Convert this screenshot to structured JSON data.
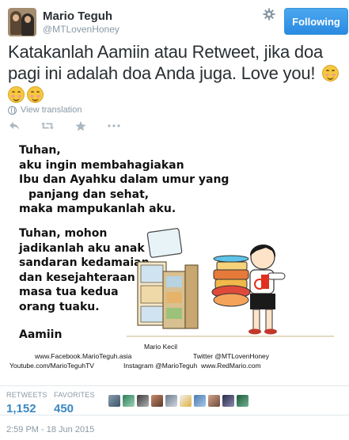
{
  "user": {
    "display_name": "Mario Teguh",
    "screen_name": "@MTLovenHoney"
  },
  "follow_button": {
    "label": "Following",
    "color": "#2b8ae0"
  },
  "tweet": {
    "line1": "Katakanlah Aamiin atau Retweet, jika doa",
    "line2": "pagi ini adalah doa Anda juga. Love you!",
    "emoji_name": "smiling-face-with-smiling-eyes-emoji"
  },
  "translate_link": "View translation",
  "actions": [
    "reply-icon",
    "retweet-icon",
    "favorite-icon",
    "more-icon"
  ],
  "image": {
    "para1": [
      "Tuhan,",
      "aku ingin membahagiakan",
      "Ibu dan Ayahku dalam umur yang",
      "panjang dan sehat,",
      "maka mampukanlah aku."
    ],
    "para2": [
      "Tuhan, mohon",
      "jadikanlah aku anak",
      "sandaran kedamaian",
      "dan kesejahteraan",
      "masa tua kedua",
      "orang tuaku."
    ],
    "closing": "Aamiin",
    "credit_name": "Mario Kecil",
    "credit_fb": "www.Facebook.MarioTeguh.asia",
    "credit_twitter": "Twitter @MTLovenHoney",
    "credit_youtube": "Youtube.com/MarioTeguhTV",
    "credit_instagram": "Instagram @MarioTeguh",
    "credit_web": "www.RedMario.com"
  },
  "stats": {
    "retweets_label": "RETWEETS",
    "retweets_count": "1,152",
    "favorites_label": "FAVORITES",
    "favorites_count": "450"
  },
  "favoriters_count_shown": 10,
  "timestamp": "2:59 PM - 18 Jun 2015"
}
